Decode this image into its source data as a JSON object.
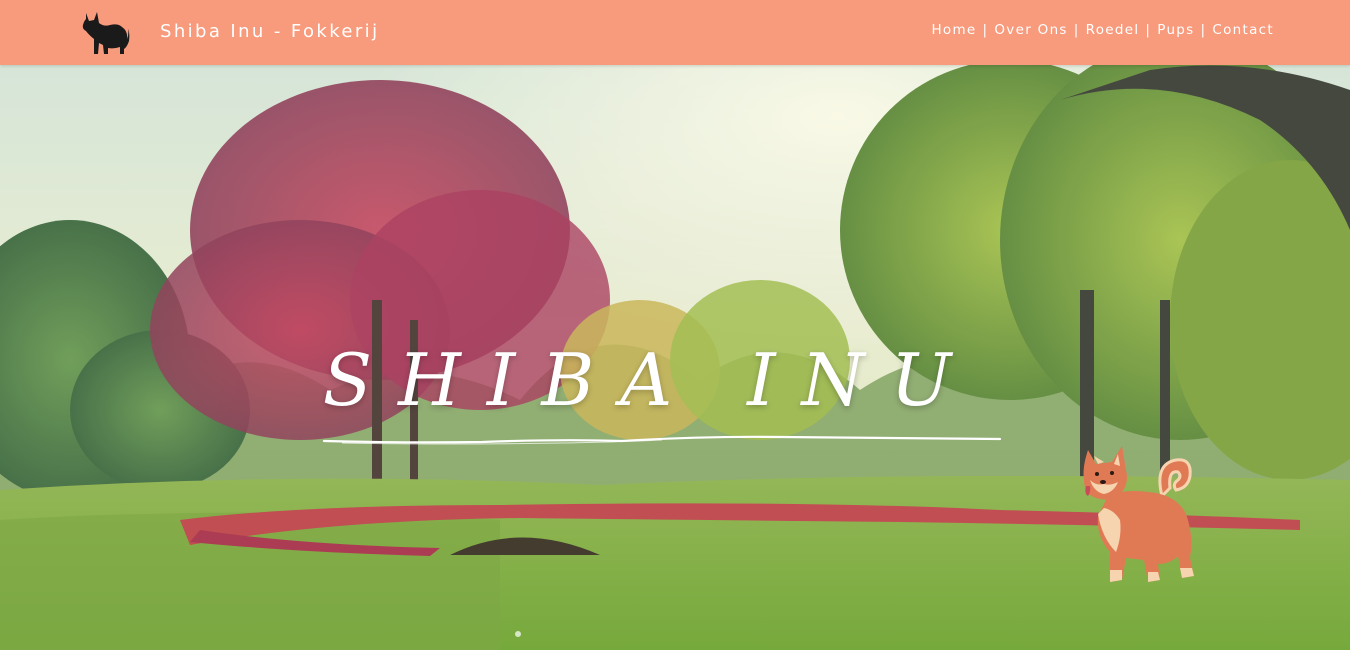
{
  "header": {
    "brand": "Shiba Inu - Fokkerij",
    "logo_icon": "shiba-silhouette-icon",
    "nav": [
      {
        "label": "Home"
      },
      {
        "label": "Over Ons"
      },
      {
        "label": "Roedel"
      },
      {
        "label": "Pups"
      },
      {
        "label": "Contact"
      }
    ],
    "nav_separator": "|"
  },
  "hero": {
    "title": "SHIBA INU",
    "illustration": "shiba-inu-illustration-icon",
    "background": "park-with-trees-image"
  },
  "colors": {
    "header_bg": "#f89a7c",
    "header_text": "#ffffff",
    "dog_orange": "#e07a55",
    "dog_cream": "#f7d4b0"
  }
}
